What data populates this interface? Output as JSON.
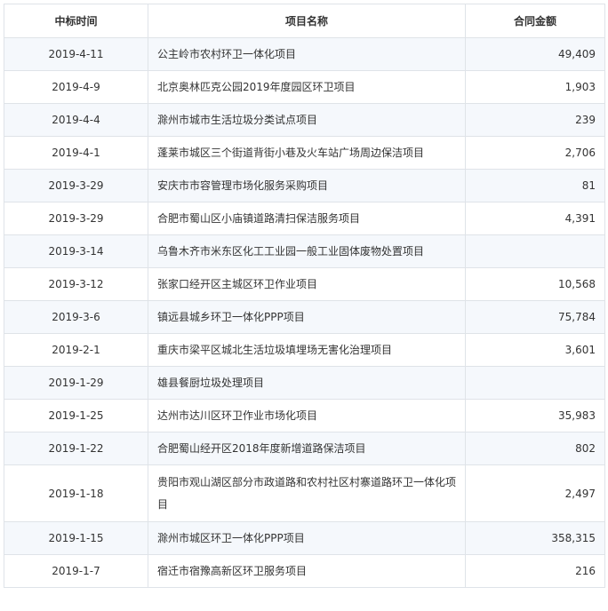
{
  "table": {
    "headers": [
      "中标时间",
      "项目名称",
      "合同金额"
    ],
    "rows": [
      {
        "date": "2019-4-11",
        "name": "公主岭市农村环卫一体化项目",
        "amount": "49,409"
      },
      {
        "date": "2019-4-9",
        "name": "北京奥林匹克公园2019年度园区环卫项目",
        "amount": "1,903"
      },
      {
        "date": "2019-4-4",
        "name": "滁州市城市生活垃圾分类试点项目",
        "amount": "239"
      },
      {
        "date": "2019-4-1",
        "name": "蓬莱市城区三个街道背街小巷及火车站广场周边保洁项目",
        "amount": "2,706"
      },
      {
        "date": "2019-3-29",
        "name": "安庆市市容管理市场化服务采购项目",
        "amount": "81"
      },
      {
        "date": "2019-3-29",
        "name": "合肥市蜀山区小庙镇道路清扫保洁服务项目",
        "amount": "4,391"
      },
      {
        "date": "2019-3-14",
        "name": "乌鲁木齐市米东区化工工业园一般工业固体废物处置项目",
        "amount": ""
      },
      {
        "date": "2019-3-12",
        "name": "张家口经开区主城区环卫作业项目",
        "amount": "10,568"
      },
      {
        "date": "2019-3-6",
        "name": "镇远县城乡环卫一体化PPP项目",
        "amount": "75,784"
      },
      {
        "date": "2019-2-1",
        "name": "重庆市梁平区城北生活垃圾填埋场无害化治理项目",
        "amount": "3,601"
      },
      {
        "date": "2019-1-29",
        "name": "雄县餐厨垃圾处理项目",
        "amount": ""
      },
      {
        "date": "2019-1-25",
        "name": "达州市达川区环卫作业市场化项目",
        "amount": "35,983"
      },
      {
        "date": "2019-1-22",
        "name": "合肥蜀山经开区2018年度新增道路保洁项目",
        "amount": "802"
      },
      {
        "date": "2019-1-18",
        "name": "贵阳市观山湖区部分市政道路和农村社区村寨道路环卫一体化项目",
        "amount": "2,497"
      },
      {
        "date": "2019-1-15",
        "name": "滁州市城区环卫一体化PPP项目",
        "amount": "358,315"
      },
      {
        "date": "2019-1-7",
        "name": "宿迁市宿豫高新区环卫服务项目",
        "amount": "216"
      }
    ]
  }
}
